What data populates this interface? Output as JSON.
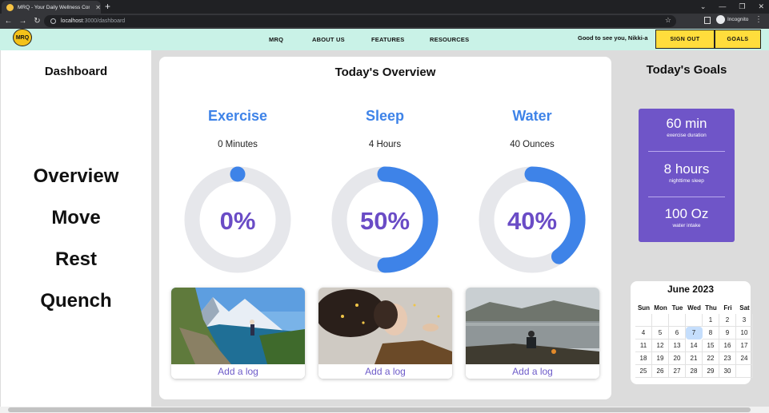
{
  "browser": {
    "tab_title": "MRQ - Your Daily Wellness Compa",
    "url_host": "localhost",
    "url_path": ":3000/dashboard",
    "incognito_label": "Incognito"
  },
  "nav": {
    "logo_text": "MRQ",
    "links": [
      "MRQ",
      "ABOUT US",
      "FEATURES",
      "RESOURCES"
    ],
    "greeting": "Good to see you, Nikki-a",
    "sign_out": "SIGN OUT",
    "goals": "GOALS"
  },
  "sidebar": {
    "title": "Dashboard",
    "items": [
      "Overview",
      "Move",
      "Rest",
      "Quench"
    ]
  },
  "overview": {
    "title": "Today's Overview",
    "ring_color": "#3e83e8",
    "track_color": "#e6e7eb",
    "metrics": [
      {
        "title": "Exercise",
        "value": "0 Minutes",
        "percent_label": "0%",
        "progress": 0
      },
      {
        "title": "Sleep",
        "value": "4 Hours",
        "percent_label": "50%",
        "progress": 0.5
      },
      {
        "title": "Water",
        "value": "40 Ounces",
        "percent_label": "40%",
        "progress": 0.4
      }
    ],
    "log_label": "Add a log"
  },
  "goals": {
    "title": "Today's Goals",
    "items": [
      {
        "value": "60 min",
        "label": "exercise duration"
      },
      {
        "value": "8 hours",
        "label": "nighttime sleep"
      },
      {
        "value": "100 Oz",
        "label": "water intake"
      }
    ]
  },
  "calendar": {
    "title": "June 2023",
    "weekdays": [
      "Sun",
      "Mon",
      "Tue",
      "Wed",
      "Thu",
      "Fri",
      "Sat"
    ],
    "weeks": [
      [
        "",
        "",
        "",
        "",
        "1",
        "2",
        "3"
      ],
      [
        "4",
        "5",
        "6",
        "7",
        "8",
        "9",
        "10"
      ],
      [
        "11",
        "12",
        "13",
        "14",
        "15",
        "16",
        "17"
      ],
      [
        "18",
        "19",
        "20",
        "21",
        "22",
        "23",
        "24"
      ],
      [
        "25",
        "26",
        "27",
        "28",
        "29",
        "30",
        ""
      ]
    ],
    "today": "7"
  }
}
